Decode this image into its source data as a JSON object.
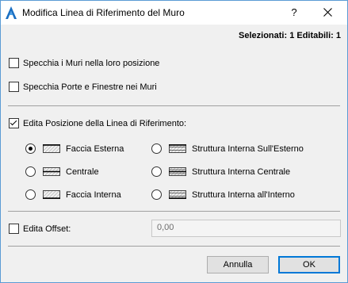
{
  "window": {
    "title": "Modifica Linea di Riferimento del Muro",
    "help_label": "?"
  },
  "status": {
    "text": "Selezionati: 1 Editabili: 1"
  },
  "options": {
    "mirror_walls": {
      "label": "Specchia i Muri nella loro posizione",
      "checked": false
    },
    "mirror_doors": {
      "label": "Specchia Porte e Finestre nei Muri",
      "checked": false
    },
    "edit_position": {
      "label": "Edita Posizione della Linea di Riferimento:",
      "checked": true
    }
  },
  "reference_positions": [
    {
      "label": "Faccia Esterna",
      "selected": true
    },
    {
      "label": "Centrale",
      "selected": false
    },
    {
      "label": "Faccia Interna",
      "selected": false
    },
    {
      "label": "Struttura Interna Sull'Esterno",
      "selected": false
    },
    {
      "label": "Struttura Interna Centrale",
      "selected": false
    },
    {
      "label": "Struttura Interna all'Interno",
      "selected": false
    }
  ],
  "offset": {
    "label": "Edita Offset:",
    "checked": false,
    "value": "0,00"
  },
  "buttons": {
    "cancel": "Annulla",
    "ok": "OK"
  },
  "colors": {
    "accent": "#0078d7",
    "window_border": "#5b9bd5",
    "background": "#f0f0f0"
  }
}
